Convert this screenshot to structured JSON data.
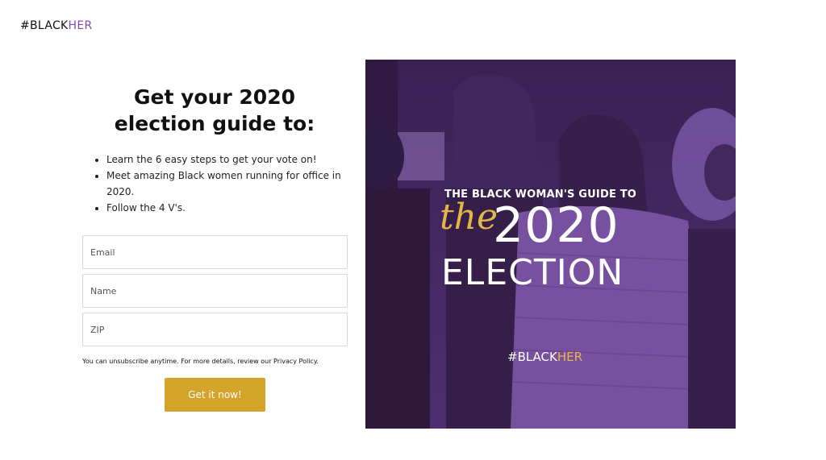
{
  "brand": {
    "prefix": "#BLACK",
    "suffix": "HER",
    "accent_color": "#7b4fa6"
  },
  "form": {
    "headline": "Get your 2020 election guide to:",
    "bullets": [
      "Learn the 6 easy steps to get your vote on!",
      "Meet amazing Black women running for office in 2020.",
      "Follow the 4 V's."
    ],
    "email_placeholder": "Email",
    "name_placeholder": "Name",
    "zip_placeholder": "ZIP",
    "note": "You can unsubscribe anytime. For more details, review our Privacy Policy.",
    "submit_label": "Get it now!",
    "button_color": "#d4a42a"
  },
  "hero": {
    "subtitle": "THE BLACK WOMAN'S GUIDE TO",
    "script_word": "the",
    "year": "2020",
    "title": "ELECTION",
    "tag_prefix": "#BLACK",
    "tag_suffix": "HER",
    "overlay_color": "#6b3f93",
    "gold_color": "#e6b548"
  }
}
